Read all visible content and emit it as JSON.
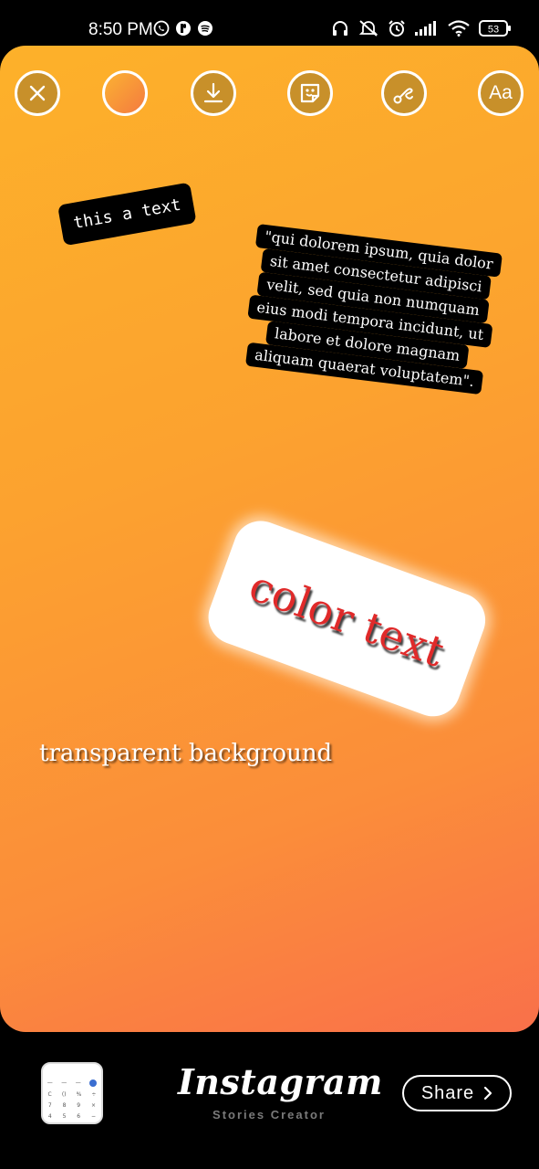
{
  "status_bar": {
    "time": "8:50 PM",
    "battery": "53",
    "left_icons": [
      "whatsapp-icon",
      "app-icon",
      "spotify-icon"
    ],
    "right_icons": [
      "headphones-icon",
      "mute-icon",
      "alarm-icon",
      "signal-icon",
      "wifi-icon",
      "battery-icon"
    ]
  },
  "toolbar": {
    "close_icon": "close-icon",
    "color_icon": "color-picker-icon",
    "download_icon": "download-icon",
    "sticker_icon": "sticker-icon",
    "draw_icon": "draw-icon",
    "text_label": "Aa"
  },
  "canvas": {
    "gradient_colors": [
      "#fdb12a",
      "#f9704a"
    ],
    "small_text": "this a text",
    "quote_lines": [
      "\"qui dolorem ipsum, quia dolor",
      "sit amet consectetur adipisci",
      "velit, sed quia non numquam",
      "eius modi tempora incidunt, ut",
      "labore et dolore magnam",
      "aliquam quaerat voluptatem\"."
    ],
    "color_text": "color text",
    "transparent_text": "transparent background"
  },
  "bottom_bar": {
    "brand": "Instagram",
    "subtitle": "Stories Creator",
    "share_label": "Share"
  }
}
